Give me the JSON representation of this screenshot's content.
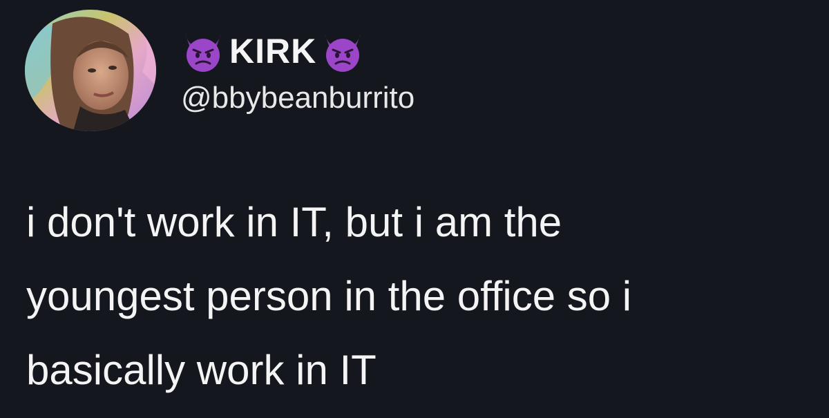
{
  "tweet": {
    "author": {
      "display_name": "KIRK",
      "handle": "@bbybeanburrito",
      "name_emoji_left": "smiling-imp-emoji",
      "name_emoji_right": "smiling-imp-emoji",
      "avatar": "profile-photo"
    },
    "text": "i don't work in IT, but i am the\nyoungest person in the office so i\nbasically work in IT"
  },
  "colors": {
    "background": "#15171f",
    "text": "#f4f4f4",
    "emoji_purple": "#9b45c9"
  }
}
